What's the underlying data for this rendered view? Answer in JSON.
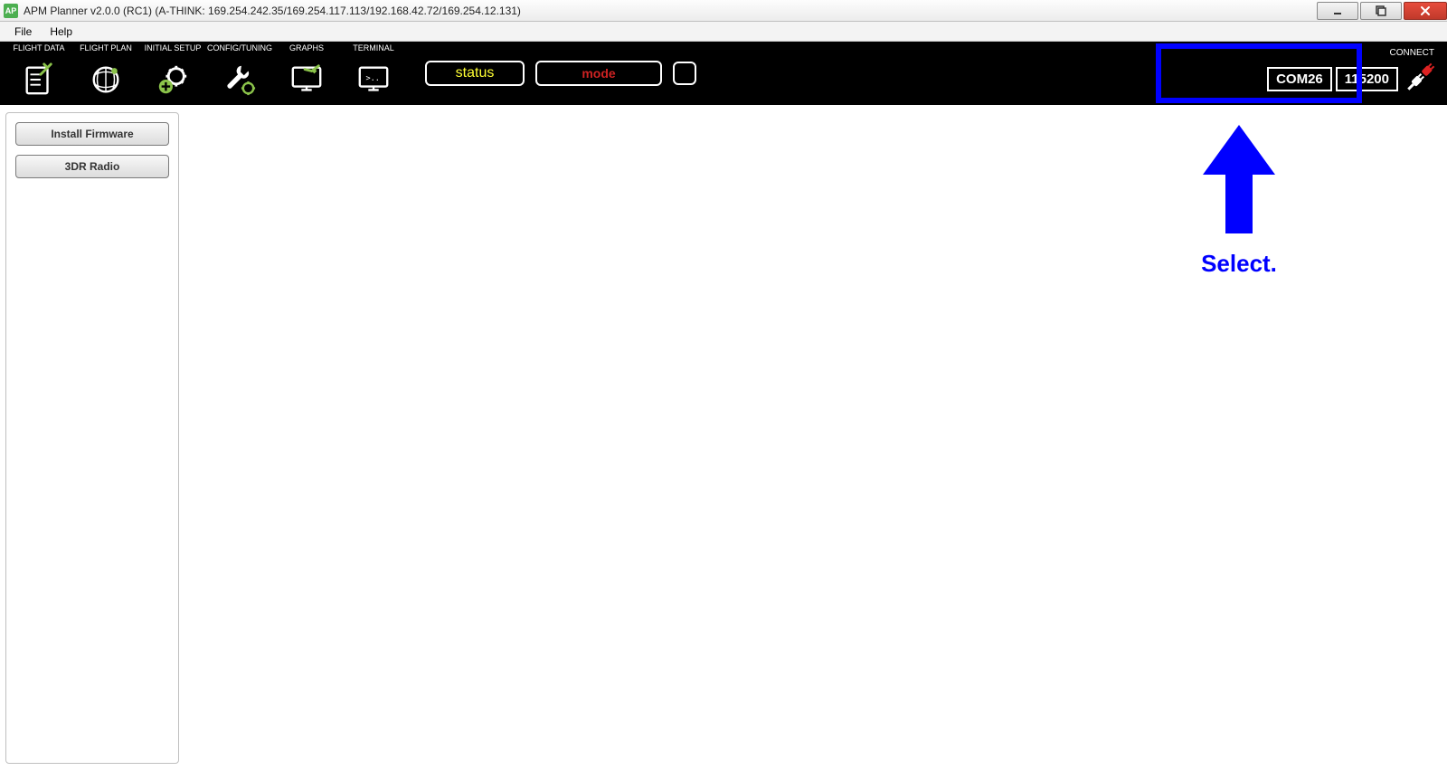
{
  "window": {
    "title": "APM Planner v2.0.0 (RC1) (A-THINK: 169.254.242.35/169.254.117.113/192.168.42.72/169.254.12.131)",
    "app_icon_text": "AP"
  },
  "menu": {
    "items": [
      "File",
      "Help"
    ]
  },
  "toolbar": {
    "items": [
      {
        "label": "FLIGHT DATA",
        "icon": "flight-data-icon"
      },
      {
        "label": "FLIGHT PLAN",
        "icon": "flight-plan-icon"
      },
      {
        "label": "INITIAL SETUP",
        "icon": "initial-setup-icon"
      },
      {
        "label": "CONFIG/TUNING",
        "icon": "config-tuning-icon"
      },
      {
        "label": "GRAPHS",
        "icon": "graphs-icon"
      },
      {
        "label": "TERMINAL",
        "icon": "terminal-icon"
      }
    ],
    "status_text": "status",
    "mode_text": "mode"
  },
  "connect": {
    "label": "CONNECT",
    "port": "COM26",
    "baud": "115200"
  },
  "sidebar": {
    "buttons": [
      "Install Firmware",
      "3DR Radio"
    ]
  },
  "annotation": {
    "text": "Select."
  }
}
